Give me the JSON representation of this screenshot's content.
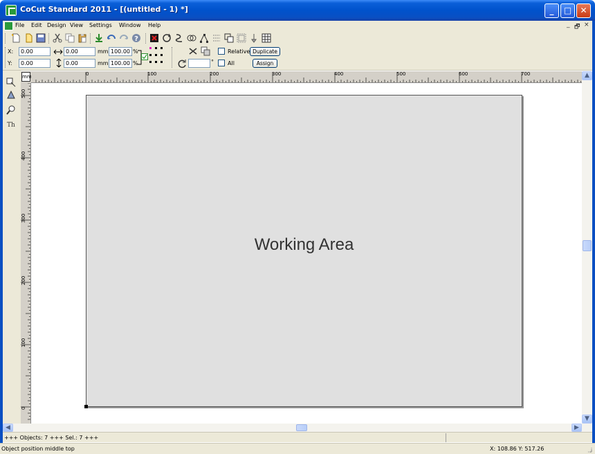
{
  "window": {
    "title": "CoCut Standard 2011 - [(untitled - 1) *]",
    "controls": {
      "minimize": "_",
      "maximize": "□",
      "close": "✕"
    }
  },
  "menubar": {
    "items": [
      "File",
      "Edit",
      "Design",
      "View",
      "Settings",
      "Window",
      "Help"
    ],
    "mdi_controls": {
      "minimize": "_",
      "restore": "🗗",
      "close": "×"
    }
  },
  "toolbar1": {
    "icons": [
      "new-icon",
      "open-icon",
      "save-icon",
      "cut-icon",
      "copy-icon",
      "paste-icon",
      "import-icon",
      "undo-icon",
      "redo-icon",
      "help-icon",
      "delete-icon",
      "rotate-icon",
      "trace-icon",
      "weld-icon",
      "node-icon",
      "optimize-icon",
      "group-icon",
      "contour-icon",
      "plot-icon",
      "grid-icon"
    ]
  },
  "toolbar2": {
    "x_label": "X:",
    "x_value": "0.00",
    "y_label": "Y:",
    "y_value": "0.00",
    "width_value": "0.00",
    "height_value": "0.00",
    "unit_w": "mm",
    "unit_h": "mm",
    "scale_w": "100.00",
    "scale_h": "100.00",
    "percent_w": "%",
    "percent_h": "%",
    "rotation_value": "",
    "degree_symbol": "°",
    "relative_label": "Relative",
    "all_label": "All",
    "duplicate_label": "Duplicate",
    "assign_label": "Assign"
  },
  "ruler": {
    "unit": "mm",
    "top_ticks": [
      "0",
      "100",
      "200",
      "300",
      "400",
      "500",
      "600",
      "700"
    ],
    "left_ticks": [
      "500",
      "400",
      "300",
      "200",
      "100",
      "0"
    ]
  },
  "canvas": {
    "working_area_label": "Working Area"
  },
  "status": {
    "objects_text": "+++ Objects: 7 +++ Sel.: 7 +++",
    "hint_text": "Object position middle top",
    "coords_text": "X: 108.86 Y: 517.26"
  }
}
